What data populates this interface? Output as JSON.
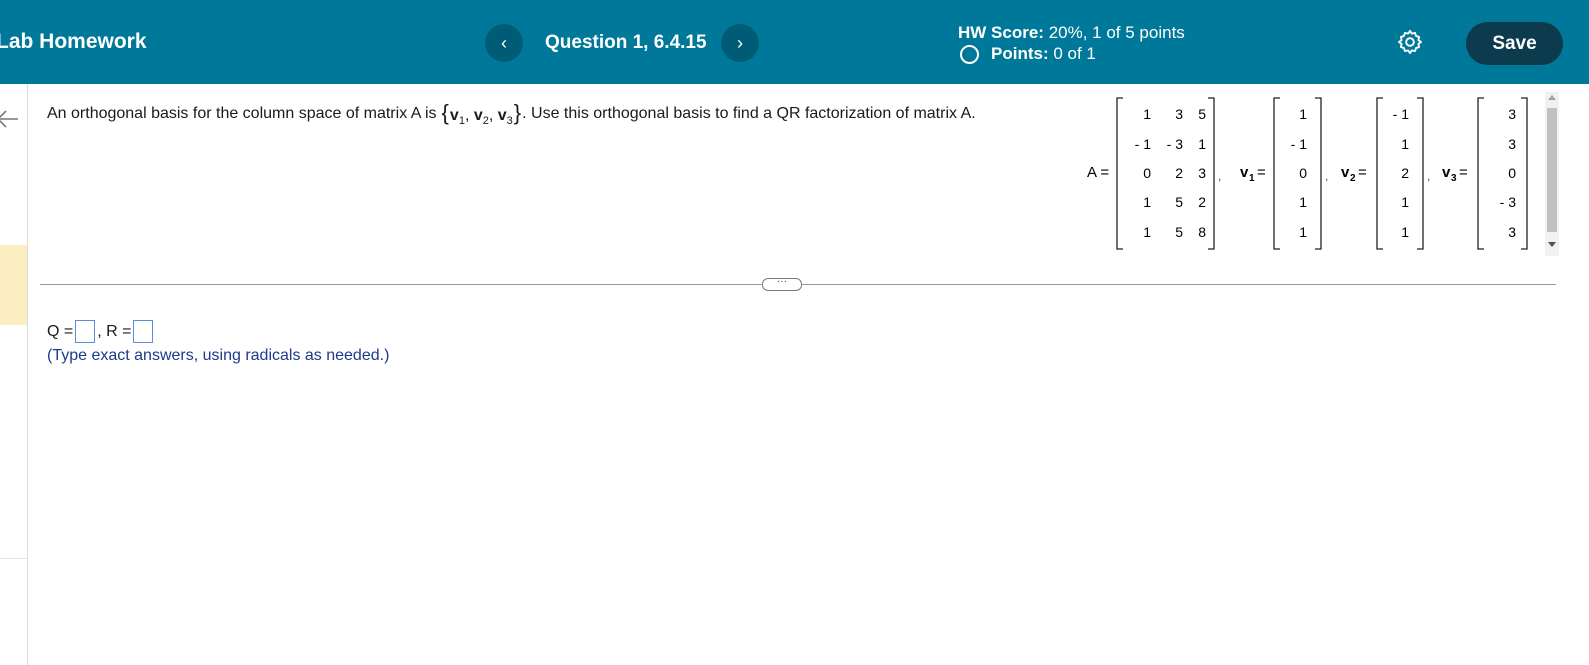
{
  "header": {
    "title": "Lab Homework",
    "prev_label": "‹",
    "next_label": "›",
    "question_title": "Question 1, 6.4.15",
    "score_label": "HW Score:",
    "score_value": "20%, 1 of 5 points",
    "points_label": "Points:",
    "points_value": "0 of 1",
    "save_label": "Save",
    "colors": {
      "bar": "#00789a",
      "save": "#0c3b4d"
    }
  },
  "problem": {
    "text_before": "An orthogonal basis for the column space of matrix A is",
    "basis_vectors": [
      "v",
      "v",
      "v"
    ],
    "basis_subs": [
      "1",
      "2",
      "3"
    ],
    "text_after": ". Use this orthogonal basis to find a QR factorization of matrix A.",
    "matrix_A_label": "A =",
    "matrix_A": [
      [
        "1",
        "3",
        "5"
      ],
      [
        "- 1",
        "- 3",
        "1"
      ],
      [
        "0",
        "2",
        "3"
      ],
      [
        "1",
        "5",
        "2"
      ],
      [
        "1",
        "5",
        "8"
      ]
    ],
    "v1_label": "v",
    "v1_sub": "1",
    "v1": [
      "1",
      "- 1",
      "0",
      "1",
      "1"
    ],
    "v2_label": "v",
    "v2_sub": "2",
    "v2": [
      "- 1",
      "1",
      "2",
      "1",
      "1"
    ],
    "v3_label": "v",
    "v3_sub": "3",
    "v3": [
      "3",
      "3",
      "0",
      "- 3",
      "3"
    ]
  },
  "answer": {
    "q_label": "Q =",
    "r_label": ", R =",
    "hint": "(Type exact answers, using radicals as needed.)"
  },
  "divider": {
    "more_label": "···"
  }
}
